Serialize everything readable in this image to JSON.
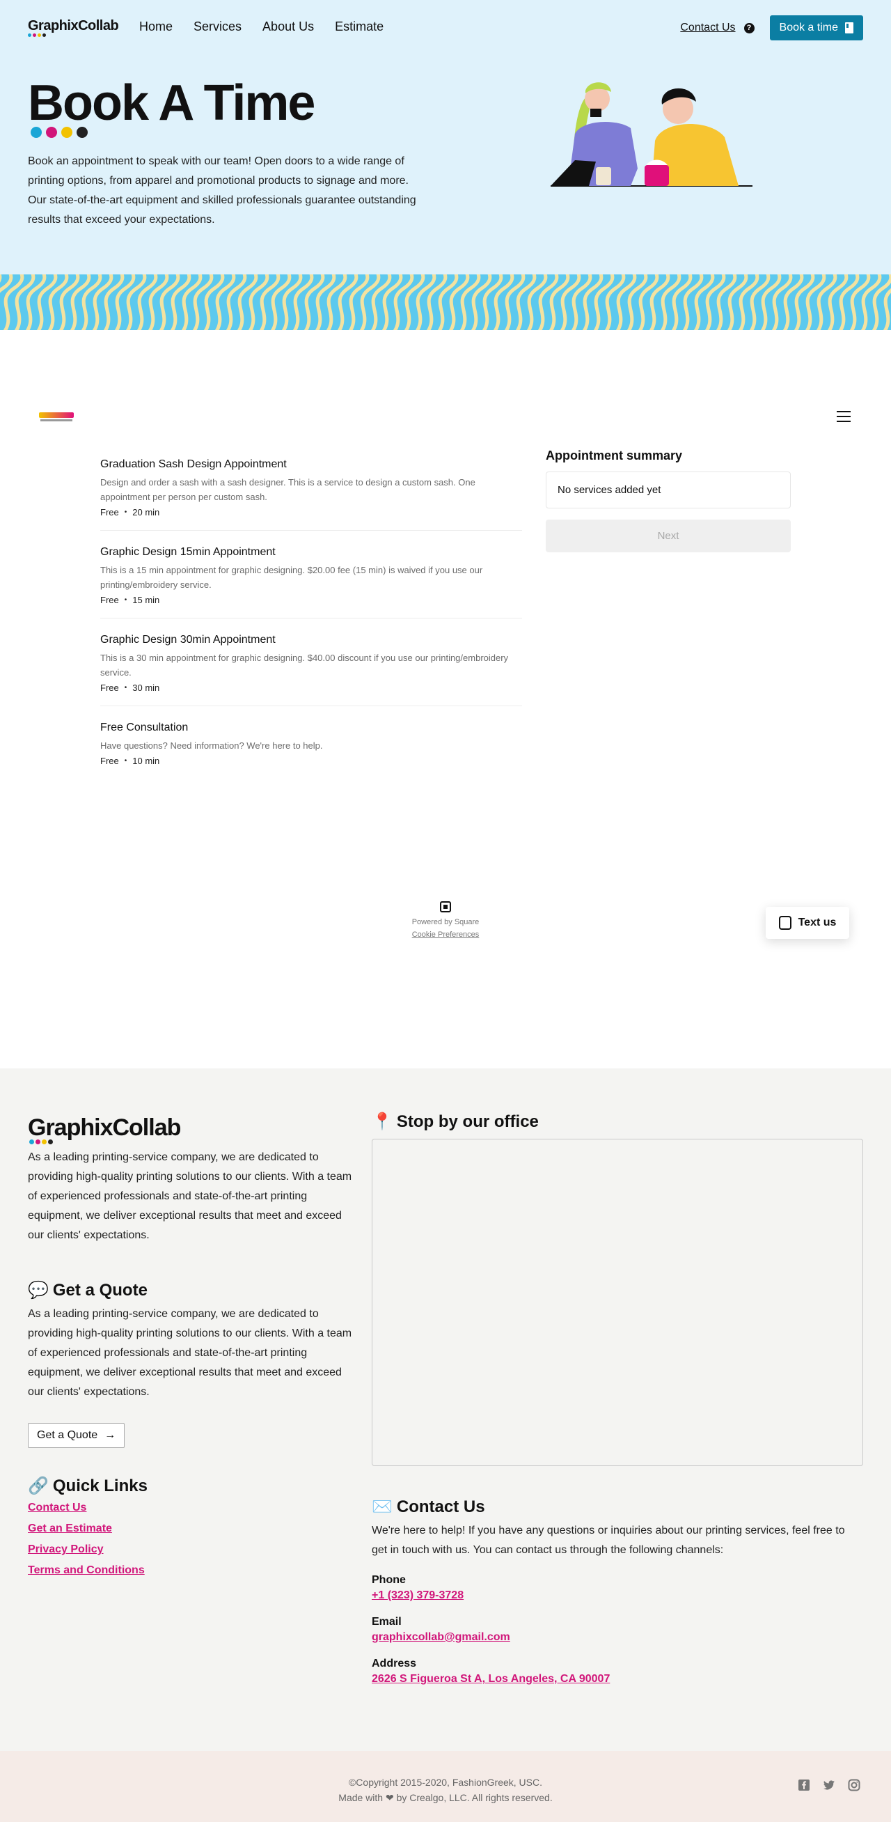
{
  "nav": {
    "logo": "GraphixCollab",
    "links": [
      "Home",
      "Services",
      "About Us",
      "Estimate"
    ],
    "contact": "Contact Us",
    "book_button": "Book a time"
  },
  "brand_colors": [
    "#1aa6d6",
    "#d1167a",
    "#f2c200",
    "#222222"
  ],
  "hero": {
    "title": "Book A Time",
    "description": "Book an appointment to speak with our team! Open doors to a wide range of printing options, from apparel and promotional products to signage and more. Our state-of-the-art equipment and skilled professionals guarantee outstanding results that exceed your expectations."
  },
  "widget": {
    "services": [
      {
        "title": "Graduation Sash Design Appointment",
        "desc": "Design and order a sash with a sash designer. This is a service to design a custom sash. One appointment per person per custom sash.",
        "price": "Free",
        "duration": "20 min"
      },
      {
        "title": "Graphic Design 15min Appointment",
        "desc": "This is a 15 min appointment for graphic designing. $20.00 fee (15 min) is waived if you use our printing/embroidery service.",
        "price": "Free",
        "duration": "15 min"
      },
      {
        "title": "Graphic Design 30min Appointment",
        "desc": "This is a 30 min appointment for graphic designing. $40.00 discount if you use our printing/embroidery service.",
        "price": "Free",
        "duration": "30 min"
      },
      {
        "title": "Free Consultation",
        "desc": "Have questions? Need information? We're here to help.",
        "price": "Free",
        "duration": "10 min"
      }
    ],
    "summary_title": "Appointment summary",
    "summary_empty": "No services added yet",
    "next_button": "Next",
    "powered_by": "Powered by Square",
    "cookie": "Cookie Preferences",
    "text_us": "Text us"
  },
  "footer": {
    "logo": "GraphixCollab",
    "about": "As a leading printing-service company, we are dedicated to providing high-quality printing solutions to our clients. With a team of experienced professionals and state-of-the-art printing equipment, we deliver exceptional results that meet and exceed our clients' expectations.",
    "quote_heading": "Get a Quote",
    "quote_text": "As a leading printing-service company, we are dedicated to providing high-quality printing solutions to our clients. With a team of experienced professionals and state-of-the-art printing equipment, we deliver exceptional results that meet and exceed our clients' expectations.",
    "quote_button": "Get a Quote",
    "quick_links_heading": "Quick Links",
    "quick_links": [
      "Contact Us",
      "Get an Estimate",
      "Privacy Policy",
      "Terms and Conditions"
    ],
    "office_heading": "Stop by our office",
    "contact_heading": "Contact Us",
    "contact_text": "We're here to help! If you have any questions or inquiries about our printing services, feel free to get in touch with us. You can contact us through the following channels:",
    "phone_label": "Phone",
    "phone": "+1 (323) 379-3728",
    "email_label": "Email",
    "email": "graphixcollab@gmail.com",
    "address_label": "Address",
    "address": "2626 S Figueroa St A, Los Angeles, CA 90007",
    "copyright": "©Copyright 2015-2020, FashionGreek, USC.",
    "made_with_prefix": "Made with",
    "made_with_suffix": "by Crealgo, LLC. All rights reserved.",
    "social_icons": [
      "facebook-icon",
      "twitter-icon",
      "instagram-icon"
    ]
  }
}
